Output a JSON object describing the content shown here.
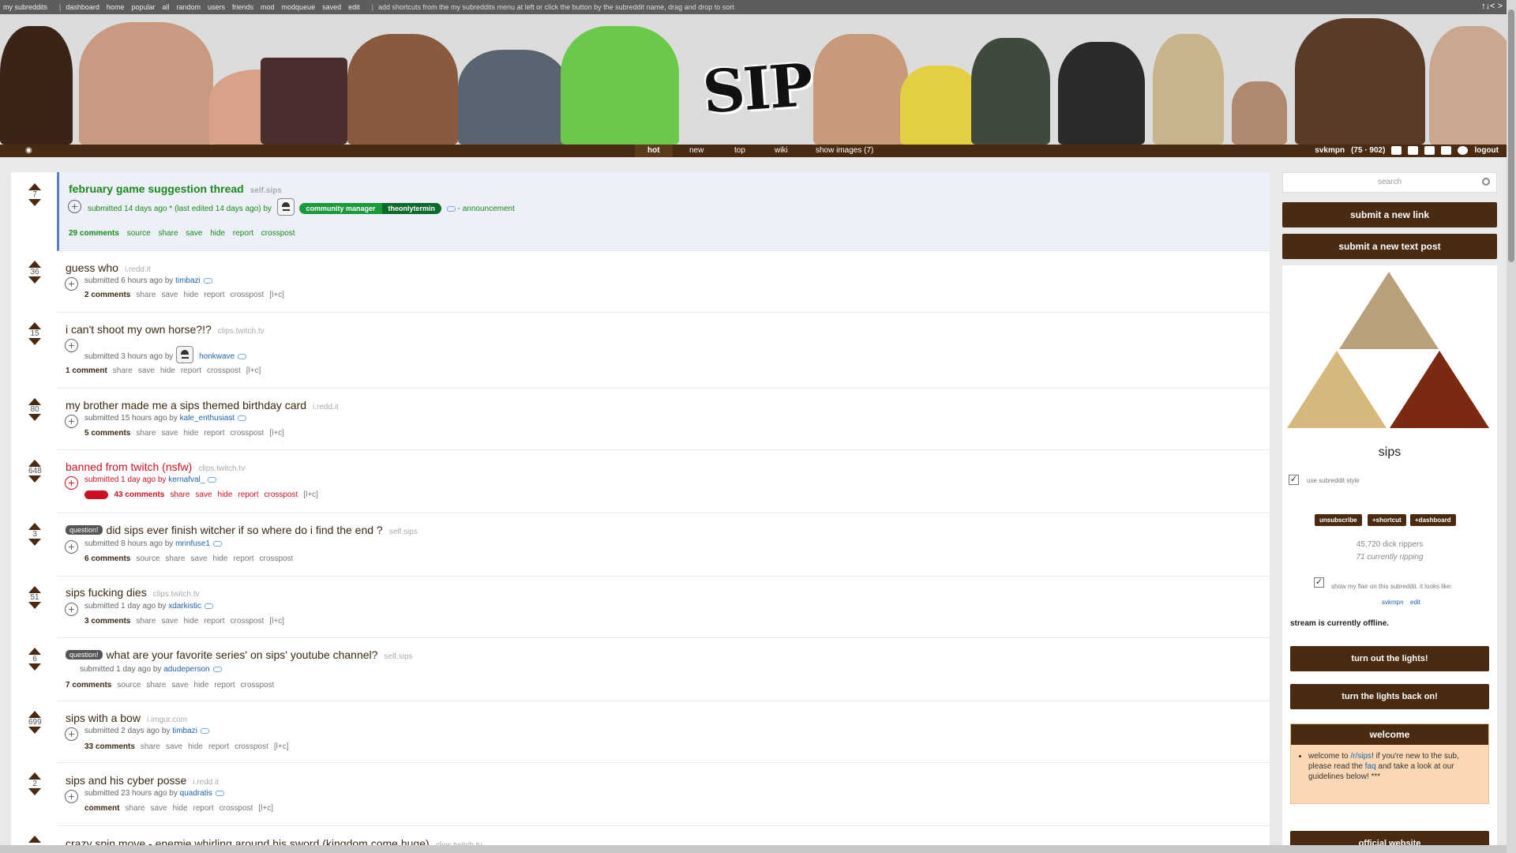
{
  "topbar": {
    "items": [
      "my subreddits",
      "dashboard",
      "home",
      "popular",
      "all",
      "random",
      "users",
      "friends",
      "mod",
      "modqueue",
      "saved",
      "edit"
    ],
    "tip": "add shortcuts from the my subreddits menu at left or click the button by the subreddit name, drag and drop to sort",
    "right": "↑↓< >"
  },
  "banner": {
    "logo": "SIPS"
  },
  "nav": {
    "tabs": [
      "hot",
      "new",
      "top",
      "wiki",
      "show images (7)"
    ],
    "selected": "hot",
    "username": "svkmpn",
    "karma": "(75 · 902)",
    "logout": "logout"
  },
  "posts": [
    {
      "score": "7",
      "title": "february game suggestion thread",
      "domain": "self.sips",
      "tagline_prefix": "submitted 14 days ago * (last edited 14 days ago) by",
      "flair1": "community manager",
      "flair2": "theonlytermin",
      "suffix": "- announcement",
      "comments": "29 comments",
      "buttons": [
        "source",
        "share",
        "save",
        "hide",
        "report",
        "crosspost"
      ]
    },
    {
      "score": "36",
      "title": "guess who",
      "domain": "i.redd.it",
      "tagline": "submitted 6 hours ago by",
      "author": "timbazi",
      "comments": "2 comments",
      "buttons": [
        "share",
        "save",
        "hide",
        "report",
        "crosspost",
        "[l+c]"
      ]
    },
    {
      "score": "15",
      "title": "i can't shoot my own horse?!?",
      "domain": "clips.twitch.tv",
      "tagline": "submitted 3 hours ago by",
      "author": "honkwave",
      "comments": "1 comment",
      "buttons": [
        "share",
        "save",
        "hide",
        "report",
        "crosspost",
        "[l+c]"
      ]
    },
    {
      "score": "80",
      "title": "my brother made me a sips themed birthday card",
      "domain": "i.redd.it",
      "tagline": "submitted 15 hours ago by",
      "author": "kale_enthusiast",
      "comments": "5 comments",
      "buttons": [
        "share",
        "save",
        "hide",
        "report",
        "crosspost",
        "[l+c]"
      ]
    },
    {
      "score": "648",
      "title": "banned from twitch (nsfw)",
      "domain": "clips.twitch.tv",
      "tagline": "submitted 1 day ago by",
      "author": "kernafval_",
      "nsfw": "nsfw",
      "comments": "43 comments",
      "buttons": [
        "share",
        "save",
        "hide",
        "report",
        "crosspost",
        "[l+c]"
      ]
    },
    {
      "score": "3",
      "badge": "question!",
      "title": "did sips ever finish witcher if so where do i find the end ?",
      "domain": "self.sips",
      "tagline": "submitted 8 hours ago by",
      "author": "mrinfuse1",
      "comments": "6 comments",
      "buttons": [
        "source",
        "share",
        "save",
        "hide",
        "report",
        "crosspost"
      ]
    },
    {
      "score": "51",
      "title": "sips fucking dies",
      "domain": "clips.twitch.tv",
      "tagline": "submitted 1 day ago by",
      "author": "xdarkistic",
      "comments": "3 comments",
      "buttons": [
        "share",
        "save",
        "hide",
        "report",
        "crosspost",
        "[l+c]"
      ]
    },
    {
      "score": "6",
      "badge": "question!",
      "title": "what are your favorite series' on sips' youtube channel?",
      "domain": "self.sips",
      "tagline": "submitted 1 day ago by",
      "author": "adudeperson",
      "comments": "7 comments",
      "buttons": [
        "source",
        "share",
        "save",
        "hide",
        "report",
        "crosspost"
      ]
    },
    {
      "score": "699",
      "title": "sips with a bow",
      "domain": "i.imgur.com",
      "tagline": "submitted 2 days ago by",
      "author": "timbazi",
      "comments": "33 comments",
      "buttons": [
        "share",
        "save",
        "hide",
        "report",
        "crosspost",
        "[l+c]"
      ]
    },
    {
      "score": "2",
      "title": "sips and his cyber posse",
      "domain": "i.redd.it",
      "tagline": "submitted 23 hours ago by",
      "author": "quadratis",
      "comments": "comment",
      "buttons": [
        "share",
        "save",
        "hide",
        "report",
        "crosspost",
        "[l+c]"
      ]
    },
    {
      "title": "crazy spin move - enemie whirling around his sword (kingdom come huge)",
      "domain": "clips.twitch.tv"
    }
  ],
  "sidebar": {
    "search_placeholder": "search",
    "submit_link": "submit a new link",
    "submit_text": "submit a new text post",
    "name": "sips",
    "use_style": "use subreddit style",
    "unsubscribe": "unsubscribe",
    "shortcut": "+shortcut",
    "dashboard": "+dashboard",
    "subscribers": "45,720 dick rippers",
    "online": "71 currently ripping",
    "flair_note": "show my flair on this subreddit. it looks like:",
    "flair_user": "svkmpn",
    "flair_edit": "edit",
    "stream_status": "stream is currently offline.",
    "lights_out": "turn out the lights!",
    "lights_on": "turn the lights back on!",
    "welcome_title": "welcome",
    "welcome_text_1": "welcome to",
    "welcome_link_1": "/r/sips",
    "welcome_text_2": "! if you're new to the sub, please read the",
    "welcome_link_2": "faq",
    "welcome_text_3": "and take a look at our guidelines below! ***",
    "official_website": "official website"
  },
  "colors": {
    "brand": "#4a2a10",
    "sticky": "#1a8a1a",
    "nsfw": "#cc1122",
    "link": "#2062b0"
  }
}
